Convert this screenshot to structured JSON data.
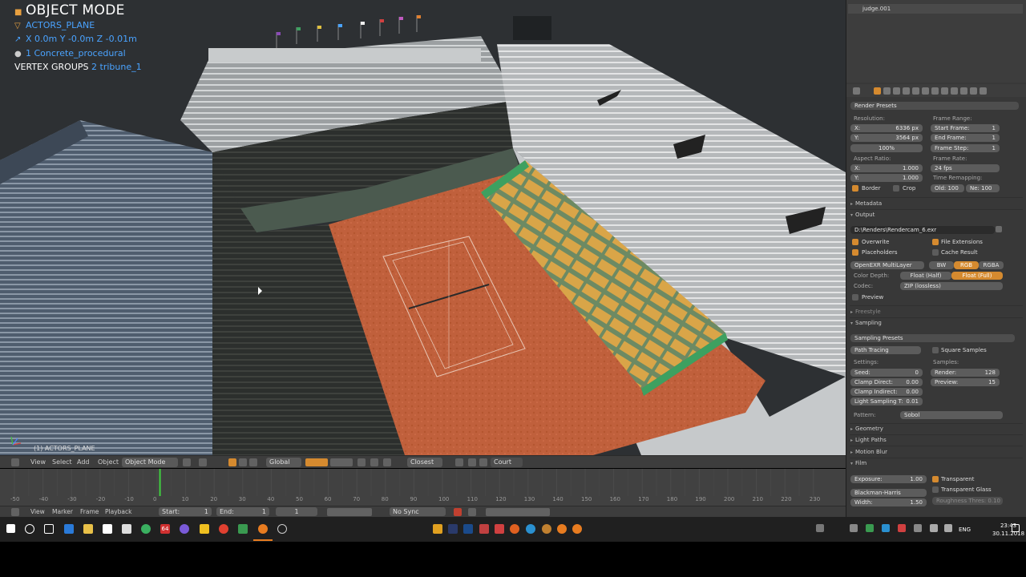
{
  "viewport": {
    "mode_title": "OBJECT MODE",
    "object_name": "ACTORS_PLANE",
    "location": "X 0.0m Y -0.0m Z -0.01m",
    "material_count": "1",
    "material_name": "Concrete_procedural",
    "vertex_groups_label": "VERTEX GROUPS",
    "vertex_groups_count": "2",
    "vertex_group_name": "tribune_1",
    "active_object_label": "(1) ACTORS_PLANE"
  },
  "view3d_header": {
    "view": "View",
    "select": "Select",
    "add": "Add",
    "object": "Object",
    "mode": "Object Mode",
    "orientation": "Global",
    "snap": "Closest",
    "layer_name": "Court"
  },
  "timeline": {
    "ticks": [
      "-50",
      "-40",
      "-30",
      "-20",
      "-10",
      "0",
      "10",
      "20",
      "30",
      "40",
      "50",
      "60",
      "70",
      "80",
      "90",
      "100",
      "110",
      "120",
      "130",
      "140",
      "150",
      "160",
      "170",
      "180",
      "190",
      "200",
      "210",
      "220",
      "230"
    ],
    "current_frame": 1,
    "view": "View",
    "marker": "Marker",
    "frame": "Frame",
    "playback": "Playback",
    "start_label": "Start:",
    "start_value": "1",
    "end_label": "End:",
    "end_value": "1",
    "frame_value": "1",
    "sync": "No Sync"
  },
  "outliner": {
    "item": "judge.001"
  },
  "properties": {
    "render_presets": "Render Presets",
    "resolution_label": "Resolution:",
    "res_x_label": "X:",
    "res_x": "6336 px",
    "res_y_label": "Y:",
    "res_y": "3564 px",
    "res_pct": "100%",
    "frame_range_label": "Frame Range:",
    "start_frame_label": "Start Frame:",
    "start_frame": "1",
    "end_frame_label": "End Frame:",
    "end_frame": "1",
    "frame_step_label": "Frame Step:",
    "frame_step": "1",
    "aspect_label": "Aspect Ratio:",
    "aspect_x_label": "X:",
    "aspect_x": "1.000",
    "aspect_y_label": "Y:",
    "aspect_y": "1.000",
    "frame_rate_label": "Frame Rate:",
    "frame_rate": "24 fps",
    "time_remap_label": "Time Remapping:",
    "old": "Old: 100",
    "new": "Ne: 100",
    "border": "Border",
    "crop": "Crop",
    "metadata": "Metadata",
    "output": "Output",
    "output_path": "D:\\Renders\\Rendercam_6.exr",
    "overwrite": "Overwrite",
    "file_extensions": "File Extensions",
    "placeholders": "Placeholders",
    "cache_result": "Cache Result",
    "file_format": "OpenEXR MultiLayer",
    "bw": "BW",
    "rgb": "RGB",
    "rgba": "RGBA",
    "color_depth_label": "Color Depth:",
    "float_half": "Float (Half)",
    "float_full": "Float (Full)",
    "codec_label": "Codec:",
    "codec": "ZIP (lossless)",
    "preview": "Preview",
    "freestyle": "Freestyle",
    "sampling": "Sampling",
    "sampling_presets": "Sampling Presets",
    "path_tracing": "Path Tracing",
    "square_samples": "Square Samples",
    "settings_label": "Settings:",
    "samples_label": "Samples:",
    "seed_label": "Seed:",
    "seed": "0",
    "render_label": "Render:",
    "render_samples": "128",
    "clamp_direct_label": "Clamp Direct:",
    "clamp_direct": "0.00",
    "preview_label": "Preview:",
    "preview_samples": "15",
    "clamp_indirect_label": "Clamp Indirect:",
    "clamp_indirect": "0.00",
    "light_sampling_label": "Light Sampling T:",
    "light_sampling": "0.01",
    "pattern_label": "Pattern:",
    "pattern": "Sobol",
    "geometry": "Geometry",
    "light_paths": "Light Paths",
    "motion_blur": "Motion Blur",
    "film": "Film",
    "exposure_label": "Exposure:",
    "exposure": "1.00",
    "transparent": "Transparent",
    "filter": "Blackman-Harris",
    "transparent_glass": "Transparent Glass",
    "width_label": "Width:",
    "width": "1.50",
    "roughness": "Roughness Thres: 0.10"
  },
  "taskbar": {
    "lang": "ENG",
    "time": "23:43",
    "date": "30.11.2018",
    "badge": "64"
  },
  "colors": {
    "accent": "#d58a2f",
    "blue_text": "#4aa3ff",
    "clay": "#c0603c"
  }
}
